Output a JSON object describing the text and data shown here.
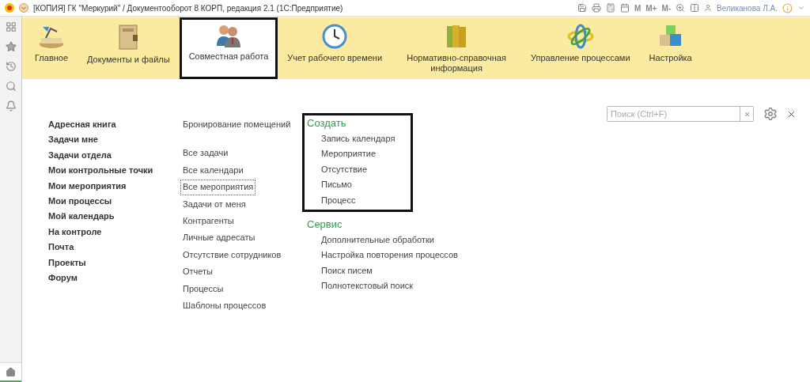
{
  "window": {
    "title": "[КОПИЯ] ГК \"Меркурий\" / Документооборот 8 КОРП, редакция 2.1  (1С:Предприятие)",
    "memory_buttons": [
      "M",
      "M+",
      "M-"
    ],
    "user": "Великанова Л.А."
  },
  "sections": [
    {
      "label": "Главное",
      "selected": false
    },
    {
      "label": "Документы и файлы",
      "selected": false
    },
    {
      "label": "Совместная работа",
      "selected": true
    },
    {
      "label": "Учет рабочего времени",
      "selected": false
    },
    {
      "label": "Нормативно-справочная информация",
      "selected": false
    },
    {
      "label": "Управление процессами",
      "selected": false
    },
    {
      "label": "Настройка",
      "selected": false
    }
  ],
  "search": {
    "placeholder": "Поиск (Ctrl+F)"
  },
  "main_links": [
    "Адресная книга",
    "Задачи мне",
    "Задачи отдела",
    "Мои контрольные точки",
    "Мои мероприятия",
    "Мои процессы",
    "Мой календарь",
    "На контроле",
    "Почта",
    "Проекты",
    "Форум"
  ],
  "top_links": [
    "Бронирование помещений"
  ],
  "links": [
    {
      "label": "Все задачи",
      "focused": false
    },
    {
      "label": "Все календари",
      "focused": false
    },
    {
      "label": "Все мероприятия",
      "focused": true
    },
    {
      "label": "Задачи от меня",
      "focused": false
    },
    {
      "label": "Контрагенты",
      "focused": false
    },
    {
      "label": "Личные адресаты",
      "focused": false
    },
    {
      "label": "Отсутствие сотрудников",
      "focused": false
    },
    {
      "label": "Отчеты",
      "focused": false
    },
    {
      "label": "Процессы",
      "focused": false
    },
    {
      "label": "Шаблоны процессов",
      "focused": false
    }
  ],
  "groups": [
    {
      "title": "Создать",
      "highlighted": true,
      "items": [
        "Запись календаря",
        "Мероприятие",
        "Отсутствие",
        "Письмо",
        "Процесс"
      ]
    },
    {
      "title": "Сервис",
      "highlighted": false,
      "items": [
        "Дополнительные обработки",
        "Настройка повторения процессов",
        "Поиск писем",
        "Полнотекстовый поиск"
      ]
    }
  ]
}
